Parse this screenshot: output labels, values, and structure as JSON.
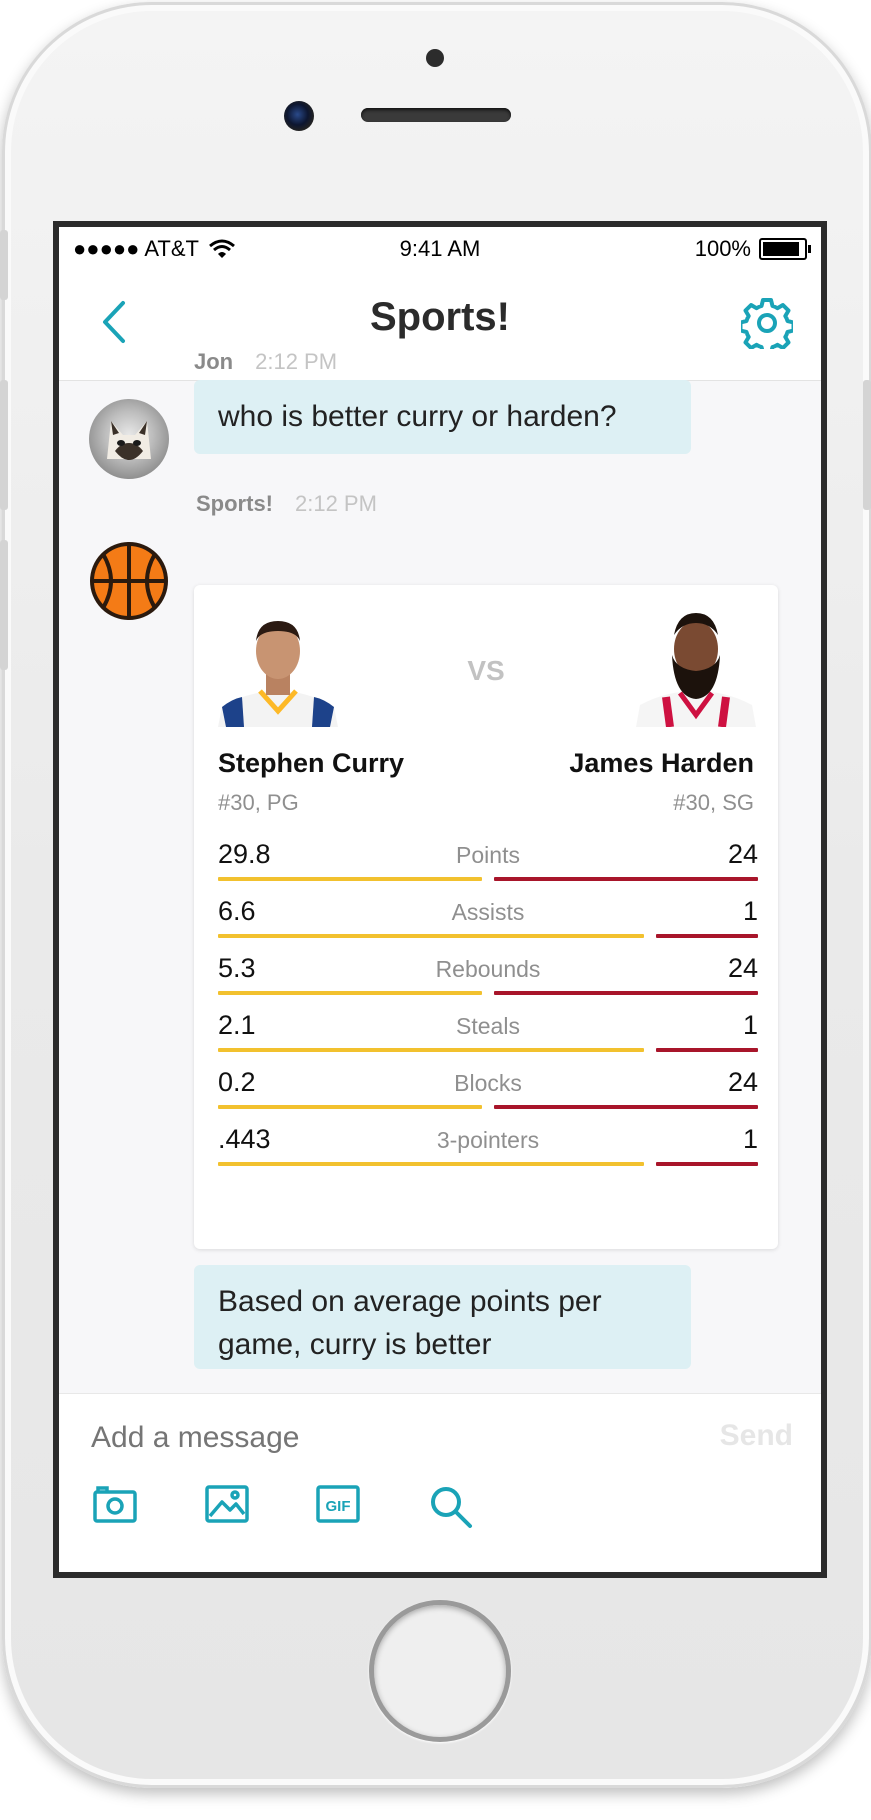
{
  "status_bar": {
    "carrier": "●●●●● AT&T",
    "time": "9:41 AM",
    "battery": "100%",
    "battery_level": 1.0
  },
  "nav": {
    "title": "Sports!",
    "back_icon": "chevron-left-icon",
    "settings_icon": "gear-icon"
  },
  "colors": {
    "accent": "#1aa3b7",
    "bubble": "#ddf0f4",
    "curry_bar": "#f2c12e",
    "harden_bar": "#a8152a"
  },
  "messages": [
    {
      "author": "Jon",
      "time": "2:12 PM",
      "text": "who is better curry or harden?"
    },
    {
      "author": "Sports!",
      "time": "2:12 PM"
    },
    {
      "text": "Based on average points per game, curry is better"
    }
  ],
  "comparison": {
    "vs": "VS",
    "left": {
      "name": "Stephen Curry",
      "sub": "#30, PG"
    },
    "right": {
      "name": "James Harden",
      "sub": "#30, SG"
    },
    "stats": [
      {
        "label": "Points",
        "left": "29.8",
        "right": "24",
        "left_fraction": 0.5,
        "right_fraction": 0.5
      },
      {
        "label": "Assists",
        "left": "6.6",
        "right": "1",
        "left_fraction": 0.8,
        "right_fraction": 0.2
      },
      {
        "label": "Rebounds",
        "left": "5.3",
        "right": "24",
        "left_fraction": 0.5,
        "right_fraction": 0.5
      },
      {
        "label": "Steals",
        "left": "2.1",
        "right": "1",
        "left_fraction": 0.8,
        "right_fraction": 0.2
      },
      {
        "label": "Blocks",
        "left": "0.2",
        "right": "24",
        "left_fraction": 0.5,
        "right_fraction": 0.5
      },
      {
        "label": "3-pointers",
        "left": ".443",
        "right": "1",
        "left_fraction": 0.8,
        "right_fraction": 0.2
      }
    ]
  },
  "composer": {
    "placeholder": "Add a message",
    "send": "Send",
    "tools": [
      "camera-icon",
      "image-icon",
      "gif-icon",
      "search-icon"
    ],
    "gif_label": "GIF"
  }
}
